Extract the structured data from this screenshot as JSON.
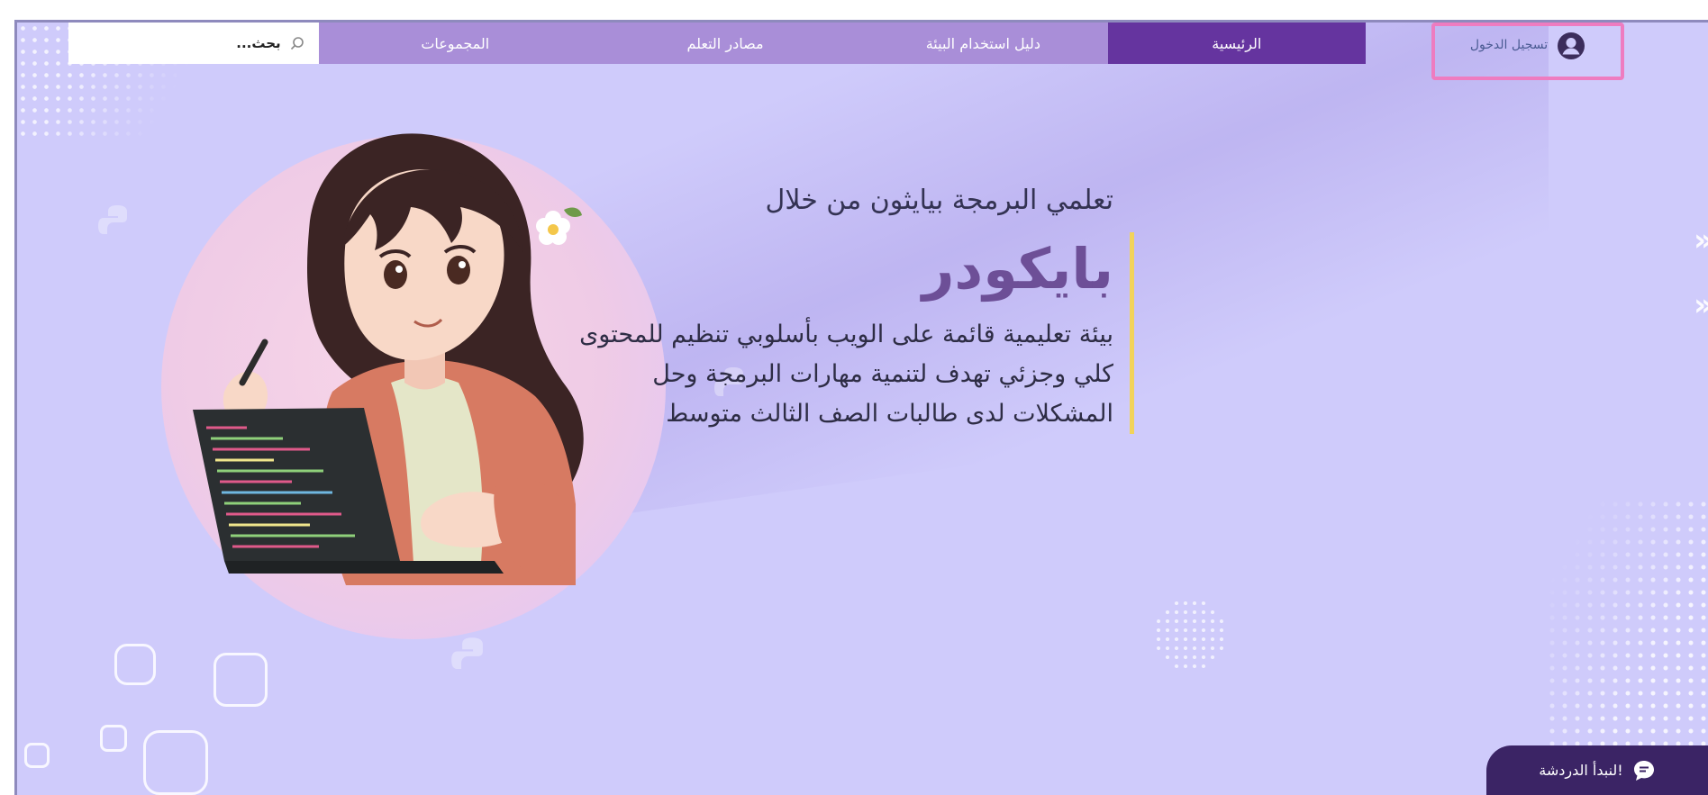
{
  "nav": {
    "search": {
      "placeholder": "بحث...",
      "icon": "search-icon"
    },
    "items": [
      {
        "label": "المجموعات",
        "active": false
      },
      {
        "label": "مصادر التعلم",
        "active": false
      },
      {
        "label": "دليل استخدام البيئة",
        "active": false
      },
      {
        "label": "الرئيسية",
        "active": true
      }
    ]
  },
  "login": {
    "label": "تسجيل الدخول",
    "icon": "user-avatar-icon"
  },
  "hero": {
    "intro": "تعلمي البرمجة بيايثون من خلال",
    "title": "بايكودر",
    "description_lines": [
      "بيئة تعليمية قائمة على الويب بأسلوبي تنظيم للمحتوى",
      "كلي وجزئي تهدف لتنمية مهارات البرمجة وحل",
      "المشكلات لدى طالبات الصف الثالث متوسط"
    ]
  },
  "chat": {
    "label": "لنبدأ الدردشة!",
    "icon": "chat-bubble-icon"
  },
  "colors": {
    "background": "#cfcbfb",
    "nav_item": "#a98ed8",
    "nav_active": "#65349f",
    "title": "#6d4f97",
    "accent_bar": "#f2d35a",
    "login_highlight": "#ee7cc0",
    "chat_button": "#3b2465"
  }
}
